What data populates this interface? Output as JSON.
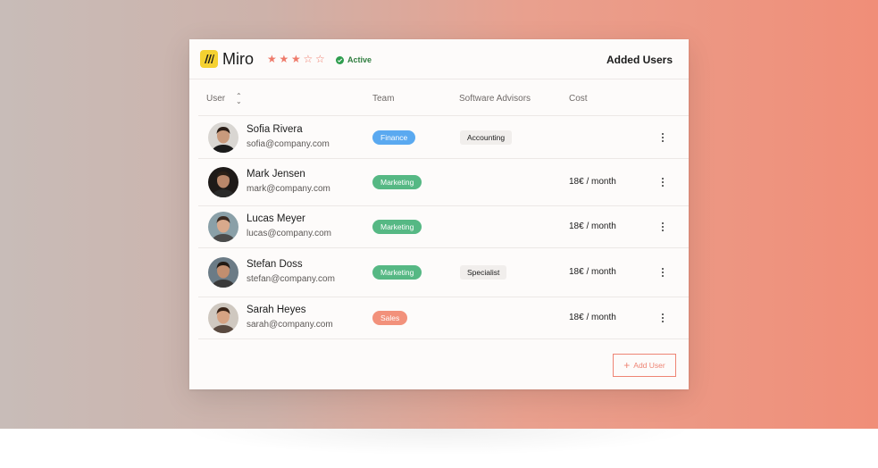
{
  "app": {
    "name": "Miro",
    "rating": 3,
    "rating_max": 5,
    "status": "Active",
    "section_title": "Added Users",
    "brand_color": "#f5d131",
    "accent_color": "#ee8474"
  },
  "columns": {
    "user": "User",
    "team": "Team",
    "advisors": "Software Advisors",
    "cost": "Cost"
  },
  "team_colors": {
    "Finance": "#5aa9f0",
    "Marketing": "#56b884",
    "Sales": "#f2917b"
  },
  "users": [
    {
      "name": "Sofia Rivera",
      "email": "sofia@company.com",
      "team": "Finance",
      "advisor": "Accounting",
      "cost": ""
    },
    {
      "name": "Mark Jensen",
      "email": "mark@company.com",
      "team": "Marketing",
      "advisor": "",
      "cost": "18€ / month"
    },
    {
      "name": "Lucas Meyer",
      "email": "lucas@company.com",
      "team": "Marketing",
      "advisor": "",
      "cost": "18€ / month"
    },
    {
      "name": "Stefan Doss",
      "email": "stefan@company.com",
      "team": "Marketing",
      "advisor": "Specialist",
      "cost": "18€ / month"
    },
    {
      "name": "Sarah Heyes",
      "email": "sarah@company.com",
      "team": "Sales",
      "advisor": "",
      "cost": "18€ / month"
    }
  ],
  "actions": {
    "add_user": "Add User"
  },
  "icons": {
    "logo": "miro-logo-icon",
    "status": "check-circle-icon",
    "sort": "sort-icon",
    "row_menu": "more-vertical-icon",
    "add": "plus-icon"
  }
}
